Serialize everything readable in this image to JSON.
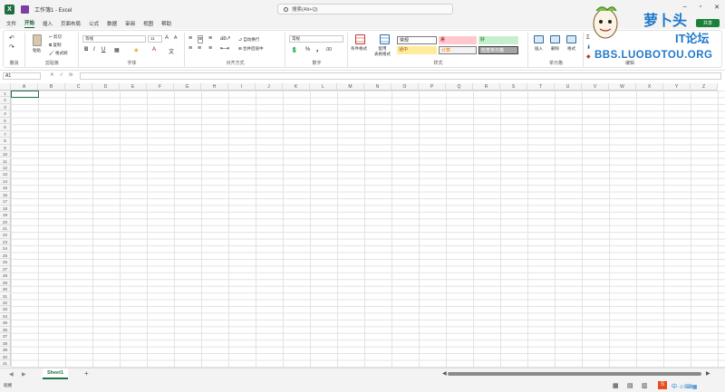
{
  "window": {
    "title": "工作簿1 - Excel",
    "search_placeholder": "搜索(Alt+Q)",
    "share_label": "共享"
  },
  "tabs": [
    "文件",
    "开始",
    "插入",
    "页面布局",
    "公式",
    "数据",
    "审阅",
    "视图",
    "帮助"
  ],
  "active_tab": "开始",
  "ribbon": {
    "undo_group": "撤消",
    "clipboard": {
      "label": "剪贴板",
      "paste": "粘贴",
      "cut": "剪切",
      "copy": "复制",
      "format_painter": "格式刷"
    },
    "font": {
      "label": "字体",
      "font_name": "等线",
      "font_size": "11"
    },
    "alignment": {
      "label": "对齐方式",
      "wrap": "自动换行",
      "merge": "合并后居中"
    },
    "number": {
      "label": "数字",
      "format": "常规"
    },
    "styles": {
      "label": "样式",
      "conditional": "条件格式",
      "as_table": "套用\n表格格式",
      "normal": "常规",
      "bad": "差",
      "good": "好",
      "neutral": "适中",
      "calc": "计算",
      "check": "检查单元格"
    },
    "cells": {
      "label": "单元格",
      "insert": "插入",
      "delete": "删除",
      "format": "格式"
    },
    "editing": {
      "label": "编辑"
    }
  },
  "formula_bar": {
    "name_box": "A1",
    "fx": "fx"
  },
  "grid": {
    "columns": [
      "A",
      "B",
      "C",
      "D",
      "E",
      "F",
      "G",
      "H",
      "I",
      "J",
      "K",
      "L",
      "M",
      "N",
      "O",
      "P",
      "Q",
      "R",
      "S",
      "T",
      "U",
      "V",
      "W",
      "X",
      "Y",
      "Z"
    ],
    "rows": [
      "1",
      "2",
      "3",
      "4",
      "5",
      "6",
      "7",
      "8",
      "9",
      "10",
      "11",
      "12",
      "13",
      "14",
      "15",
      "16",
      "17",
      "18",
      "19",
      "20",
      "21",
      "22",
      "23",
      "24",
      "25",
      "26",
      "27",
      "28",
      "29",
      "30",
      "31",
      "32",
      "33",
      "34",
      "35",
      "36",
      "37",
      "38",
      "39",
      "40",
      "41"
    ]
  },
  "sheets": [
    "Sheet1"
  ],
  "status": {
    "ready": "就绪"
  },
  "watermark": {
    "brand": "萝卜头",
    "sub": "IT论坛",
    "url": "BBS.LUOBOTOU.ORG"
  },
  "colors": {
    "accent": "#217346",
    "share": "#1a7f37"
  }
}
